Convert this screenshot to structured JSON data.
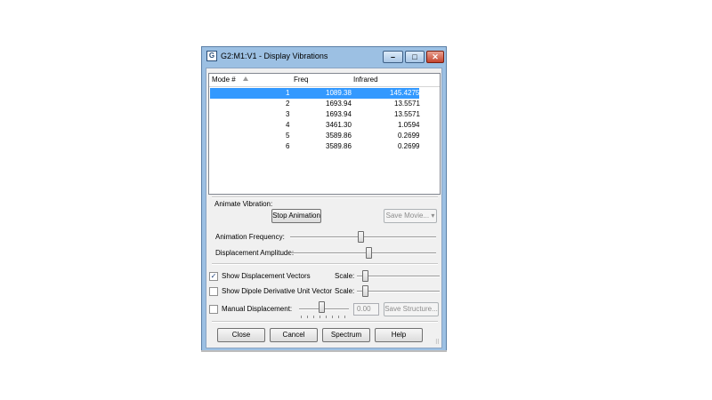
{
  "window": {
    "title": "G2:M1:V1 - Display Vibrations",
    "icon": "gaussview-app-icon"
  },
  "listview": {
    "headers": {
      "mode": "Mode #",
      "freq": "Freq",
      "infrared": "Infrared"
    },
    "rows": [
      {
        "mode": "1",
        "freq": "1089.38",
        "infrared": "145.4275",
        "selected": true
      },
      {
        "mode": "2",
        "freq": "1693.94",
        "infrared": "13.5571",
        "selected": false
      },
      {
        "mode": "3",
        "freq": "1693.94",
        "infrared": "13.5571",
        "selected": false
      },
      {
        "mode": "4",
        "freq": "3461.30",
        "infrared": "1.0594",
        "selected": false
      },
      {
        "mode": "5",
        "freq": "3589.86",
        "infrared": "0.2699",
        "selected": false
      },
      {
        "mode": "6",
        "freq": "3589.86",
        "infrared": "0.2699",
        "selected": false
      }
    ]
  },
  "animate": {
    "group_label": "Animate Vibration:",
    "stop_button": "Stop Animation",
    "save_movie": "Save Movie...",
    "frequency_label": "Animation Frequency:",
    "amplitude_label": "Displacement Amplitude:"
  },
  "options": {
    "show_vectors_label": "Show Displacement Vectors",
    "show_vectors_checked": true,
    "show_dipole_label": "Show Dipole Derivative Unit Vector",
    "show_dipole_checked": false,
    "scale_label": "Scale:",
    "manual_label": "Manual Displacement:",
    "manual_checked": false,
    "manual_value": "0.00",
    "save_structure": "Save Structure..."
  },
  "buttons": {
    "close": "Close",
    "cancel": "Cancel",
    "spectrum": "Spectrum",
    "help": "Help"
  },
  "colors": {
    "selection": "#3399ff",
    "frame": "#9cc0e3"
  }
}
